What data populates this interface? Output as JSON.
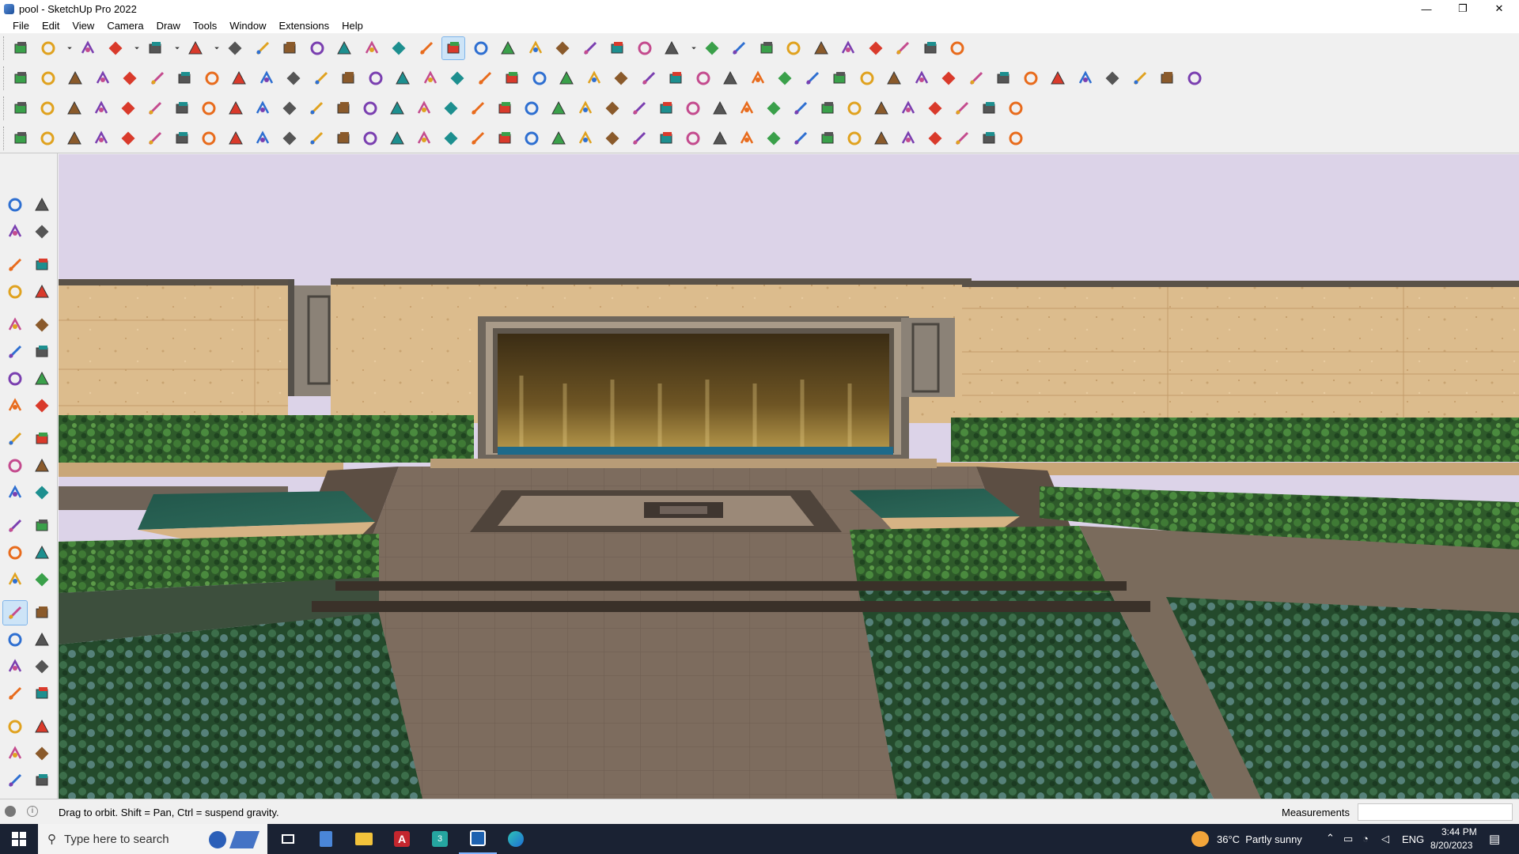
{
  "window": {
    "title": "pool - SketchUp Pro 2022",
    "minimize": "—",
    "maximize": "❐",
    "close": "✕"
  },
  "menu": [
    "File",
    "Edit",
    "View",
    "Camera",
    "Draw",
    "Tools",
    "Window",
    "Extensions",
    "Help"
  ],
  "toolbar_row1": [
    "search-icon",
    "select-arrow-icon",
    "dropdown-chevron-icon",
    "eraser-icon",
    "pencil-icon",
    "dropdown-chevron-icon",
    "arc-icon",
    "dropdown-chevron-icon",
    "rectangle-icon",
    "dropdown-chevron-icon",
    "push-pull-icon",
    "follow-me-icon",
    "move-icon",
    "rotate-icon",
    "scale-icon",
    "tape-measure-icon",
    "text-icon",
    "paint-bucket-icon",
    "orbit-icon",
    "pan-hand-icon",
    "zoom-icon",
    "zoom-extents-icon",
    "section-plane-icon",
    "display-section-icon",
    "layers-icon",
    "section-fill-icon",
    "camera-position-icon",
    "dropdown-chevron-icon",
    "components-icon",
    "materials-icon",
    "styles-icon",
    "flip-blue-icon",
    "flip-red-icon",
    "axis-icon",
    "intersect-icon",
    "undo-icon",
    "redo-icon",
    "extension-icon"
  ],
  "toolbar_row2": [
    "solid-union-icon",
    "solid-subtract-icon",
    "solid-trim-icon",
    "push-pull-extend-icon",
    "offset-down-icon",
    "offset-blue-icon",
    "offset-red-icon",
    "offset-green-icon",
    "offset-north-icon",
    "offset-orange-icon",
    "offset-pink-icon",
    "curve-icon",
    "face-icon",
    "face-icon",
    "face-icon",
    "terrain-icon",
    "sandbox-icon",
    "building-icon",
    "wall-icon",
    "house-icon",
    "roof-icon",
    "home-outline-icon",
    "shelter-icon",
    "function-icon",
    "leaf-icon",
    "brush-icon",
    "polygon-square-icon",
    "circle-icon",
    "hexagon-icon",
    "ellipse-icon",
    "parallelogram-icon",
    "arc-tool-icon",
    "spiral-icon",
    "tag-icon",
    "loop-icon",
    "knife-icon",
    "pink-eraser-icon",
    "solid-brown-icon",
    "grid-icon",
    "gear-shape-icon",
    "vault-icon",
    "stone-icon",
    "texture-icon",
    "slope-icon"
  ],
  "toolbar_row3": [
    "cube-blue-icon",
    "plane-blue-icon",
    "plane-yellow-icon",
    "text-label-icon",
    "plane-red-icon",
    "flat-panel-icon",
    "loop-arrow-icon",
    "red-square-icon",
    "hatched-square-icon",
    "flag-icon",
    "box-wood-icon",
    "link-icon",
    "curve-arc-icon",
    "dotted-curve-icon",
    "cross-red-icon",
    "cross-green-icon",
    "cross-blue-icon",
    "cone-icon",
    "blob-icon",
    "triangle-icon",
    "ring-icon",
    "knot-icon",
    "loop-dots-icon",
    "arrows-icon",
    "bucket-icon",
    "hook-icon",
    "green-block-icon",
    "connector-icon",
    "nodes-icon",
    "nodes-pink-icon",
    "gem-icon",
    "gear-multi-icon",
    "frame-icon",
    "tiles-icon",
    "grid-square-icon",
    "scatter-icon",
    "circle-dots-icon",
    "array-icon"
  ],
  "toolbar_row4": [
    "line-path-icon",
    "curve-path-icon",
    "fillet-icon",
    "polyline-icon",
    "wave-icon",
    "twist-icon",
    "sphere-icon",
    "helix-icon",
    "triangle-3d-icon",
    "corner-icon",
    "corner2-icon",
    "diagonal-icon",
    "bend-icon",
    "cylinder-icon",
    "leaf-shape-icon",
    "bars-icon",
    "comb-icon",
    "glove-icon",
    "fold-icon",
    "star-fold-icon",
    "stack-icon",
    "slant-icon",
    "fan-icon",
    "scissors-icon",
    "split-icon",
    "cube-stack-icon",
    "stripes-icon",
    "pillar-icon",
    "stairs-icon",
    "grid-fill-icon",
    "mesh-icon",
    "hatch-icon",
    "columns-icon",
    "sphere-mesh-icon",
    "gear-mesh-icon",
    "wedge-icon",
    "fan-mesh-icon",
    "arrow-3d-icon"
  ],
  "left_tools": [
    "select-icon",
    "orbit-small-icon",
    "paint-icon",
    "eraser-small-icon",
    "component-icon",
    "tape-icon",
    "pencil-small-icon",
    "freehand-icon",
    "rectangle-small-icon",
    "rotated-rectangle-icon",
    "circle-small-icon",
    "polygon-small-icon",
    "arc-small-icon",
    "pie-icon",
    "arc2-icon",
    "arc3-icon",
    "move-small-icon",
    "push-pull-small-icon",
    "rotate-small-icon",
    "follow-me-small-icon",
    "scale-small-icon",
    "offset-icon",
    "tape-measure-small-icon",
    "dimension-icon",
    "protractor-icon",
    "text-small-icon",
    "axes-icon",
    "3d-text-icon",
    "orbit-active-icon",
    "pan-icon",
    "zoom-small-icon",
    "zoom-window-icon",
    "zoom-extents-small-icon",
    "previous-view-icon",
    "position-camera-icon",
    "look-around-icon",
    "walk-icon",
    "section-small-icon",
    "section-plane-small-icon",
    "section-display-icon",
    "section-fill-small-icon",
    "section-cut-icon"
  ],
  "status": {
    "hint": "Drag to orbit. Shift = Pan, Ctrl = suspend gravity.",
    "measurements_label": "Measurements"
  },
  "taskbar": {
    "search_placeholder": "Type here to search",
    "weather": "36°C  Partly sunny",
    "language": "ENG",
    "time": "3:44 PM",
    "date": "8/20/2023"
  },
  "colors": {
    "sky": "#dcd3e8",
    "stone": "#d9b98a",
    "hedge": "#2f5a2c",
    "water": "#1e6a8a",
    "selected_tool": "#cde4f7"
  }
}
